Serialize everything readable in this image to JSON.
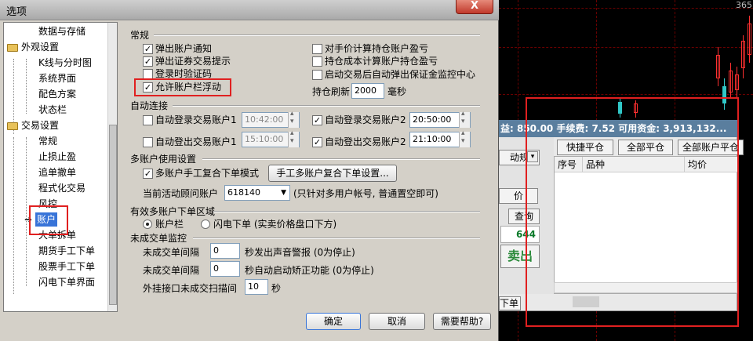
{
  "dialog": {
    "title": "选项",
    "close_label": "X"
  },
  "tree": {
    "items": [
      {
        "label": "数据与存储"
      },
      {
        "label": "外观设置"
      },
      {
        "label": "K线与分时图"
      },
      {
        "label": "系统界面"
      },
      {
        "label": "配色方案"
      },
      {
        "label": "状态栏"
      },
      {
        "label": "交易设置"
      },
      {
        "label": "常规"
      },
      {
        "label": "止损止盈"
      },
      {
        "label": "追单撤单"
      },
      {
        "label": "程式化交易"
      },
      {
        "label": "风控"
      },
      {
        "label": "账户"
      },
      {
        "label": "大单拆单"
      },
      {
        "label": "期货手工下单"
      },
      {
        "label": "股票手工下单"
      },
      {
        "label": "闪电下单界面"
      }
    ]
  },
  "general": {
    "title": "常规",
    "opt1": "弹出账户通知",
    "opt2": "弹出证券交易提示",
    "opt3": "登录时验证码",
    "opt4": "允许账户栏浮动",
    "opt5": "对手价计算持仓账户盈亏",
    "opt6": "持仓成本计算账户持仓盈亏",
    "opt7": "启动交易后自动弹出保证金监控中心",
    "refresh_label": "持仓刷新",
    "refresh_value": "2000",
    "refresh_unit": "毫秒"
  },
  "auto_connect": {
    "title": "自动连接",
    "login1_label": "自动登录交易账户1",
    "login1_time": "10:42:00",
    "login2_label": "自动登录交易账户2",
    "login2_time": "20:50:00",
    "logout1_label": "自动登出交易账户1",
    "logout1_time": "15:10:00",
    "logout2_label": "自动登出交易账户2",
    "logout2_time": "21:10:00"
  },
  "multi_account": {
    "title": "多账户使用设置",
    "manual_label": "多账户手工复合下单模式",
    "manual_btn": "手工多账户复合下单设置...",
    "active_label": "当前活动顾问账户",
    "active_value": "618140",
    "active_note": "(只针对多用户帐号, 普通置空即可)"
  },
  "order_area": {
    "title": "有效多账户下单区域",
    "radio1": "账户栏",
    "radio2": "闪电下单 (实卖价格盘口下方)"
  },
  "unfilled": {
    "title": "未成交单监控",
    "row1_label": "未成交单间隔",
    "row1_value": "0",
    "row1_note": "秒发出声音警报 (0为停止)",
    "row2_label": "未成交单间隔",
    "row2_value": "0",
    "row2_note": "秒自动启动矫正功能 (0为停止)",
    "row3_label": "外挂接口未成交扫描间",
    "row3_value": "10",
    "row3_unit": "秒"
  },
  "buttons": {
    "ok": "确定",
    "cancel": "取消",
    "help": "需要帮助?"
  },
  "trade_panel": {
    "bar_text": "益: 850.00    手续费: 7.52    可用资金: 3,913,132...",
    "btn_close_fast": "快捷平仓",
    "btn_close_all": "全部平仓",
    "btn_close_all_accounts": "全部账户平仓",
    "col_seq": "序号",
    "col_variety": "品种",
    "col_avg": "均价",
    "left_label1": "动规",
    "left_label2": "价",
    "left_query": "查询",
    "left_price": "644",
    "left_sell": "卖出",
    "tab_label": "下单",
    "top_number": "365"
  },
  "colors": {
    "highlight_red": "#e02020",
    "candle_red": "#ff3030",
    "candle_cyan": "#30c8c8"
  }
}
